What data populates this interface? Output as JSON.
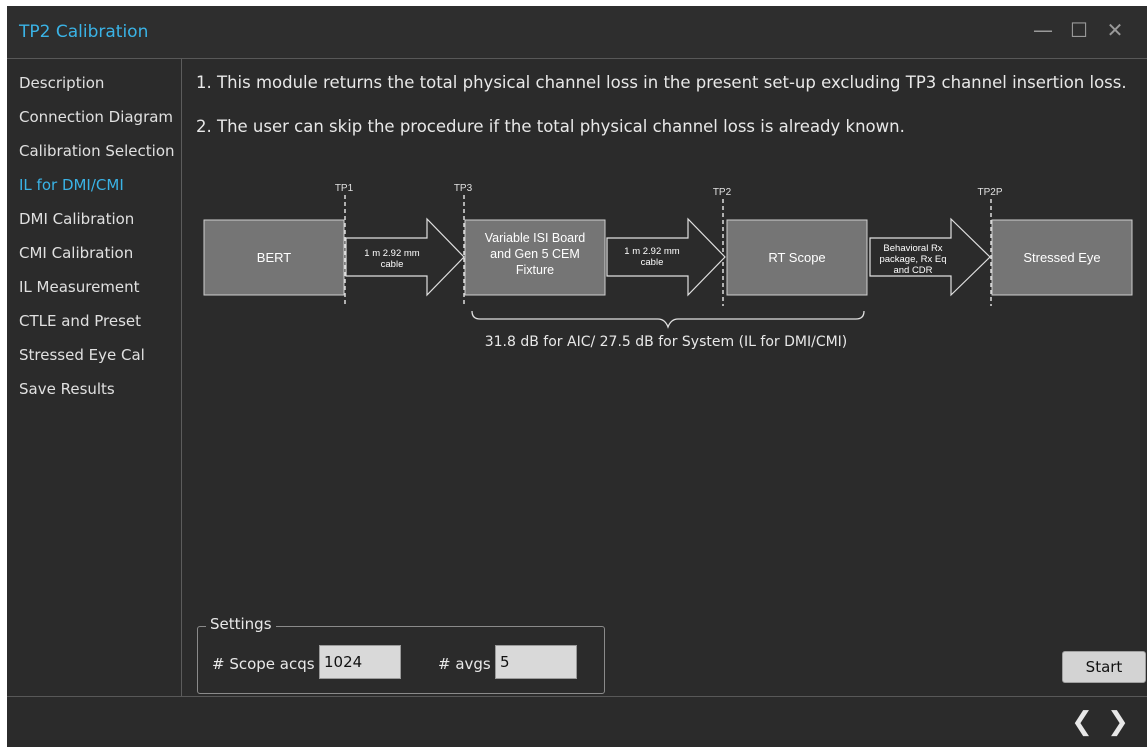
{
  "window": {
    "title": "TP2 Calibration",
    "controls": {
      "minimize": "—",
      "maximize": "☐",
      "close": "✕"
    }
  },
  "sidebar": {
    "items": [
      {
        "label": "Description"
      },
      {
        "label": "Connection Diagram"
      },
      {
        "label": "Calibration Selection"
      },
      {
        "label": "IL for DMI/CMI"
      },
      {
        "label": "DMI Calibration"
      },
      {
        "label": "CMI Calibration"
      },
      {
        "label": "IL Measurement"
      },
      {
        "label": "CTLE and Preset"
      },
      {
        "label": "Stressed Eye Cal"
      },
      {
        "label": "Save Results"
      }
    ],
    "active_index": 3
  },
  "main": {
    "description_lines": [
      "1. This module returns the total physical channel loss in the present set-up excluding TP3 channel insertion loss.",
      "2. The user can skip the procedure if the total physical channel loss is already known."
    ]
  },
  "diagram": {
    "test_points": [
      "TP1",
      "TP3",
      "TP2",
      "TP2P"
    ],
    "boxes": [
      {
        "lines": [
          "BERT"
        ]
      },
      {
        "lines": [
          "Variable ISI Board",
          "and Gen 5 CEM",
          "Fixture"
        ]
      },
      {
        "lines": [
          "RT Scope"
        ]
      },
      {
        "lines": [
          "Stressed Eye"
        ]
      }
    ],
    "arrows": [
      {
        "lines": [
          "1 m 2.92 mm",
          "cable"
        ]
      },
      {
        "lines": [
          "1 m 2.92 mm",
          "cable"
        ]
      },
      {
        "lines": [
          "Behavioral Rx",
          "package, Rx Eq",
          "and CDR"
        ]
      }
    ],
    "brace_label": "31.8 dB for AIC/ 27.5 dB for System (IL for DMI/CMI)"
  },
  "settings": {
    "legend": "Settings",
    "scope_acqs_label": "# Scope acqs",
    "scope_acqs_value": "1024",
    "avgs_label": "# avgs",
    "avgs_value": "5"
  },
  "start_label": "Start",
  "footer": {
    "prev": "❮",
    "next": "❯"
  },
  "colors": {
    "accent": "#3ab3e6",
    "window_bg": "#2b2b2b",
    "box_fill": "#757575"
  }
}
